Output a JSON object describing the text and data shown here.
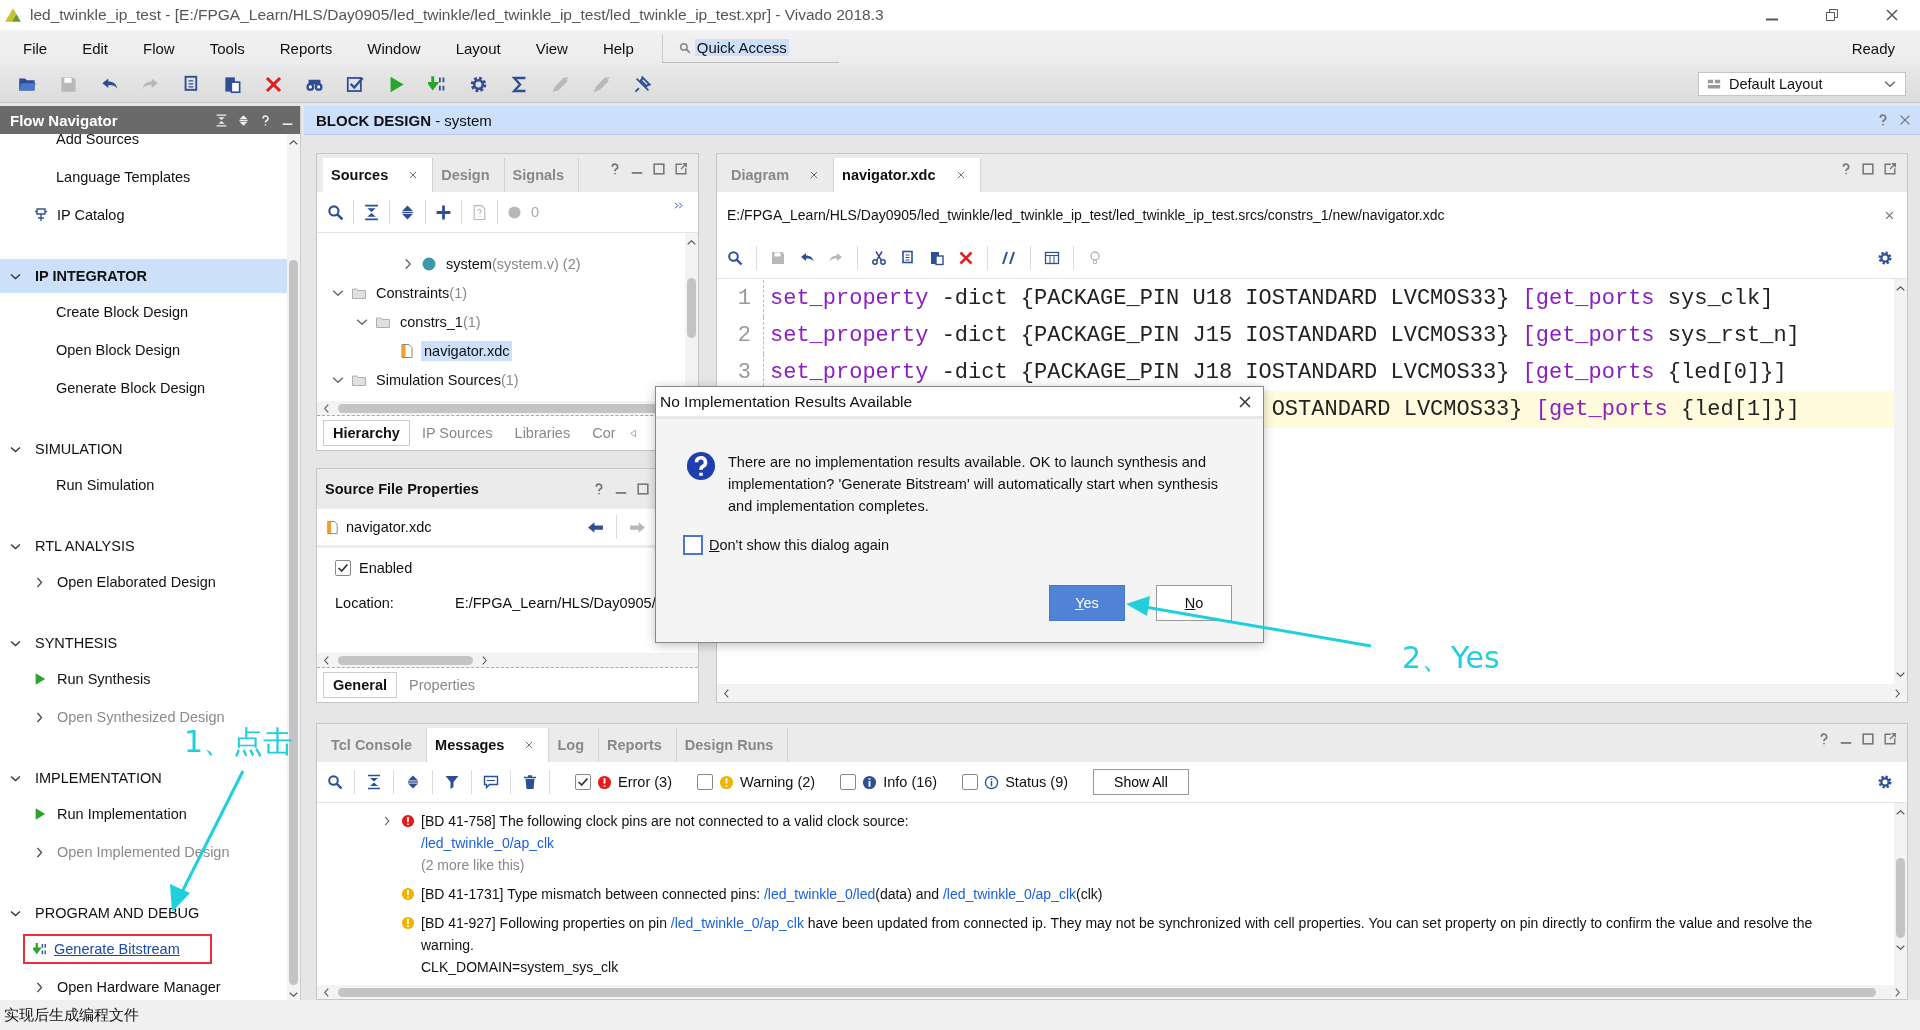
{
  "window": {
    "title": "led_twinkle_ip_test - [E:/FPGA_Learn/HLS/Day0905/led_twinkle/led_twinkle_ip_test/led_twinkle_ip_test.xpr] - Vivado 2018.3"
  },
  "menu": [
    "File",
    "Edit",
    "Flow",
    "Tools",
    "Reports",
    "Window",
    "Layout",
    "View",
    "Help"
  ],
  "quick_access": {
    "value": "Quick Access"
  },
  "status": "Ready",
  "layout_dropdown": {
    "value": "Default Layout"
  },
  "flow_navigator": {
    "title": "Flow Navigator",
    "sections": [
      {
        "items": [
          {
            "label": "Add Sources",
            "kind": "plain",
            "disabled": false,
            "boxed": false
          },
          {
            "label": "Language Templates",
            "kind": "plain",
            "disabled": false,
            "boxed": false
          },
          {
            "label": "IP Catalog",
            "kind": "catalog",
            "disabled": false,
            "boxed": false
          }
        ]
      },
      {
        "title": "IP INTEGRATOR",
        "selected": true,
        "expanded": true,
        "items": [
          {
            "label": "Create Block Design",
            "kind": "plain",
            "disabled": false,
            "boxed": false
          },
          {
            "label": "Open Block Design",
            "kind": "plain",
            "disabled": false,
            "boxed": false
          },
          {
            "label": "Generate Block Design",
            "kind": "plain",
            "disabled": false,
            "boxed": false
          }
        ]
      },
      {
        "title": "SIMULATION",
        "selected": false,
        "expanded": true,
        "items": [
          {
            "label": "Run Simulation",
            "kind": "plain",
            "disabled": false,
            "boxed": false
          }
        ]
      },
      {
        "title": "RTL ANALYSIS",
        "selected": false,
        "expanded": true,
        "items": [
          {
            "label": "Open Elaborated Design",
            "kind": "expandable",
            "disabled": false,
            "boxed": false
          }
        ]
      },
      {
        "title": "SYNTHESIS",
        "selected": false,
        "expanded": true,
        "items": [
          {
            "label": "Run Synthesis",
            "kind": "run",
            "disabled": false,
            "boxed": false
          },
          {
            "label": "Open Synthesized Design",
            "kind": "expandable",
            "disabled": true,
            "boxed": false
          }
        ]
      },
      {
        "title": "IMPLEMENTATION",
        "selected": false,
        "expanded": true,
        "items": [
          {
            "label": "Run Implementation",
            "kind": "run",
            "disabled": false,
            "boxed": false
          },
          {
            "label": "Open Implemented Design",
            "kind": "expandable",
            "disabled": true,
            "boxed": false
          }
        ]
      },
      {
        "title": "PROGRAM AND DEBUG",
        "selected": false,
        "expanded": true,
        "items": [
          {
            "label": "Generate Bitstream",
            "kind": "bitstream",
            "disabled": false,
            "boxed": true
          },
          {
            "label": "Open Hardware Manager",
            "kind": "expandable",
            "disabled": false,
            "boxed": false
          }
        ]
      }
    ]
  },
  "header": "**BLOCK DESIGN** - system",
  "sources": {
    "tabs": [
      {
        "label": "Sources",
        "selected": true,
        "closable": true
      },
      {
        "label": "Design",
        "selected": false,
        "closable": false
      },
      {
        "label": "Signals",
        "selected": false,
        "closable": false
      }
    ],
    "count": "0",
    "tree": [
      {
        "label": "system",
        "detail": "(system.v) (2)",
        "kind": "module",
        "expanded": false,
        "selected": false
      },
      {
        "label": "Constraints",
        "detail": "(1)",
        "kind": "folder",
        "expanded": true,
        "selected": false,
        "children": [
          {
            "label": "constrs_1",
            "detail": "(1)",
            "kind": "folder",
            "expanded": true,
            "selected": false,
            "children": [
              {
                "label": "navigator.xdc",
                "kind": "file",
                "selected": true
              }
            ]
          }
        ]
      },
      {
        "label": "Simulation Sources",
        "detail": "(1)",
        "kind": "folder",
        "expanded": true,
        "selected": false
      }
    ],
    "view_tabs": [
      {
        "label": "Hierarchy",
        "selected": true
      },
      {
        "label": "IP Sources",
        "selected": false
      },
      {
        "label": "Libraries",
        "selected": false
      },
      {
        "label": "Cor",
        "selected": false
      }
    ]
  },
  "file_properties": {
    "title": "Source File Properties",
    "file": "navigator.xdc",
    "enabled": {
      "label": "Enabled",
      "checked": true
    },
    "location": {
      "label": "Location:",
      "value": "E:/FPGA_Learn/HLS/Day0905/"
    },
    "tabs": [
      {
        "label": "General",
        "selected": true
      },
      {
        "label": "Properties",
        "selected": false
      }
    ]
  },
  "editor": {
    "tabs": [
      {
        "label": "Diagram",
        "selected": false
      },
      {
        "label": "navigator.xdc",
        "selected": true
      }
    ],
    "path": "E:/FPGA_Learn/HLS/Day0905/led_twinkle/led_twinkle_ip_test/led_twinkle_ip_test.srcs/constrs_1/new/navigator.xdc",
    "lines": [
      {
        "number": "1",
        "highlighted": false,
        "tokens": [
          {
            "text": "set_property",
            "kind": "keyword"
          },
          {
            "text": " -dict {PACKAGE_PIN U18 IOSTANDARD LVCMOS33} ",
            "kind": "plain"
          },
          {
            "text": "[get_ports",
            "kind": "keyword"
          },
          {
            "text": " sys_clk]",
            "kind": "plain"
          }
        ]
      },
      {
        "number": "2",
        "highlighted": false,
        "tokens": [
          {
            "text": "set_property",
            "kind": "keyword"
          },
          {
            "text": " -dict {PACKAGE_PIN J15 IOSTANDARD LVCMOS33} ",
            "kind": "plain"
          },
          {
            "text": "[get_ports",
            "kind": "keyword"
          },
          {
            "text": " sys_rst_n]",
            "kind": "plain"
          }
        ]
      },
      {
        "number": "3",
        "highlighted": false,
        "tokens": [
          {
            "text": "set_property",
            "kind": "keyword"
          },
          {
            "text": " -dict {PACKAGE_PIN J18 IOSTANDARD LVCMOS33} ",
            "kind": "plain"
          },
          {
            "text": "[get_ports",
            "kind": "keyword"
          },
          {
            "text": " {led[0]}]",
            "kind": "plain"
          }
        ]
      },
      {
        "highlighted": true,
        "tokens": [
          {
            "text": "OSTANDARD LVCMOS33} ",
            "kind": "plain"
          },
          {
            "text": "[get_ports",
            "kind": "keyword"
          },
          {
            "text": " {led[1]}]",
            "kind": "plain"
          }
        ]
      }
    ]
  },
  "messages": {
    "tabs": [
      {
        "label": "Tcl Console",
        "selected": false,
        "closable": false
      },
      {
        "label": "Messages",
        "selected": true,
        "closable": true
      },
      {
        "label": "Log",
        "selected": false,
        "closable": false
      },
      {
        "label": "Reports",
        "selected": false,
        "closable": false
      },
      {
        "label": "Design Runs",
        "selected": false,
        "closable": false
      }
    ],
    "filters": [
      {
        "label": "Error (3)",
        "kind": "error",
        "checked": true
      },
      {
        "label": "Warning (2)",
        "kind": "warning",
        "checked": false
      },
      {
        "label": "Info (16)",
        "kind": "info",
        "checked": false
      },
      {
        "label": "Status (9)",
        "kind": "status",
        "checked": false
      }
    ],
    "show_all": "Show All",
    "items": [
      {
        "kind": "error",
        "expandable": true,
        "lines": [
          [
            {
              "text": "[BD 41-758] The following clock pins are not connected to a valid clock source:",
              "kind": "text"
            }
          ],
          [
            {
              "text": "/led_twinkle_0/ap_clk",
              "kind": "link"
            }
          ],
          [
            {
              "text": "(2 more like this)",
              "kind": "note"
            }
          ]
        ]
      },
      {
        "kind": "warning",
        "expandable": false,
        "lines": [
          [
            {
              "text": "[BD 41-1731] Type mismatch between connected pins: ",
              "kind": "text"
            },
            {
              "text": "/led_twinkle_0/led",
              "kind": "link"
            },
            {
              "text": "(data) and ",
              "kind": "text"
            },
            {
              "text": "/led_twinkle_0/ap_clk",
              "kind": "link"
            },
            {
              "text": "(clk)",
              "kind": "text"
            }
          ]
        ]
      },
      {
        "kind": "warning",
        "expandable": false,
        "lines": [
          [
            {
              "text": "[BD 41-927] Following properties on pin ",
              "kind": "text"
            },
            {
              "text": "/led_twinkle_0/ap_clk",
              "kind": "link"
            },
            {
              "text": " have been updated from connected ip. They may not be synchronized with cell properties. You can set property on pin directly to confirm the value and resolve the warning.",
              "kind": "text"
            }
          ],
          [
            {
              "text": "CLK_DOMAIN=system_sys_clk",
              "kind": "text"
            }
          ]
        ]
      }
    ]
  },
  "dialog": {
    "title": "No Implementation Results Available",
    "message": "There are no implementation results available. OK to launch synthesis and implementation? 'Generate Bitstream' will automatically start when synthesis and implementation completes.",
    "checkbox": {
      "label": "Don't show this dialog again",
      "checked": false
    },
    "buttons": [
      {
        "label": "Yes",
        "default": true
      },
      {
        "label": "No",
        "default": false
      }
    ]
  },
  "annotations": [
    {
      "text": "1、点击"
    },
    {
      "text": "2、Yes"
    }
  ],
  "status_bar": "实现后生成编程文件"
}
